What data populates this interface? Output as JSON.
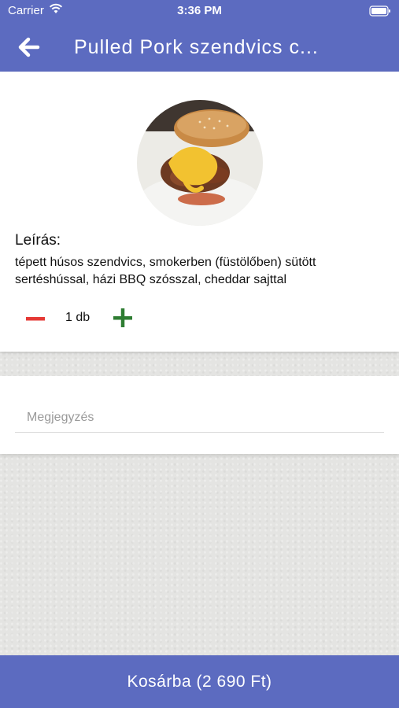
{
  "status_bar": {
    "carrier": "Carrier",
    "time": "3:36 PM",
    "wifi_icon": "wifi-icon",
    "battery_icon": "battery-icon"
  },
  "app_bar": {
    "title": "Pulled Pork szendvics c...",
    "back_icon": "arrow-left-icon",
    "color": "#5c6bc0"
  },
  "product": {
    "image": "pulled-pork-sandwich-photo",
    "description_label": "Leírás:",
    "description": "tépett húsos szendvics, smokerben (füstölőben) sütött sertéshússal, házi BBQ szósszal, cheddar sajttal",
    "quantity": {
      "value_label": "1 db",
      "minus_color": "#e53935",
      "plus_color": "#2e7d32"
    }
  },
  "note": {
    "placeholder": "Megjegyzés",
    "value": ""
  },
  "cart_button": {
    "label": "Kosárba (2 690 Ft)"
  }
}
